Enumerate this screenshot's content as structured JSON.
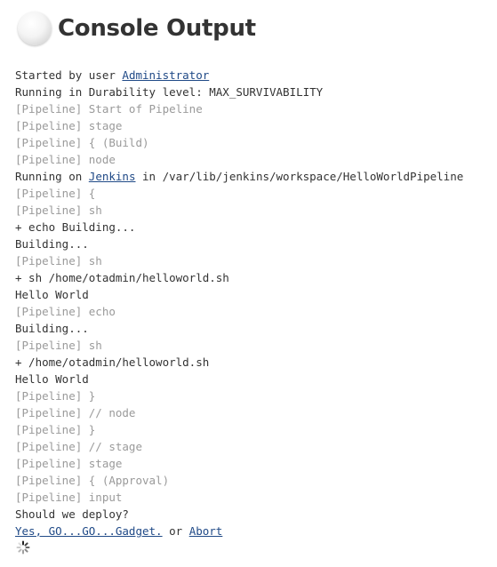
{
  "page": {
    "title": "Console Output"
  },
  "console": {
    "line1_prefix": "Started by user ",
    "line1_user_link": "Administrator",
    "line2": "Running in Durability level: MAX_SURVIVABILITY",
    "line3": "[Pipeline] Start of Pipeline",
    "line4": "[Pipeline] stage",
    "line5": "[Pipeline] { (Build)",
    "line6": "[Pipeline] node",
    "line7_prefix": "Running on ",
    "line7_link": "Jenkins",
    "line7_suffix": " in /var/lib/jenkins/workspace/HelloWorldPipeline",
    "line8": "[Pipeline] {",
    "line9": "[Pipeline] sh",
    "line10": "+ echo Building...",
    "line11": "Building...",
    "line12": "[Pipeline] sh",
    "line13": "+ sh /home/otadmin/helloworld.sh",
    "line14": "Hello World",
    "line15": "[Pipeline] echo",
    "line16": "Building...",
    "line17": "[Pipeline] sh",
    "line18": "+ /home/otadmin/helloworld.sh",
    "line19": "Hello World",
    "line20": "[Pipeline] }",
    "line21": "[Pipeline] // node",
    "line22": "[Pipeline] }",
    "line23": "[Pipeline] // stage",
    "line24": "[Pipeline] stage",
    "line25": "[Pipeline] { (Approval)",
    "line26": "[Pipeline] input",
    "line27": "Should we deploy?",
    "proceed_link": "Yes, GO...GO...Gadget.",
    "or_text": " or ",
    "abort_link": "Abort"
  },
  "icons": {
    "status": "build-status-ball-icon",
    "progress": "loading-spinner-icon"
  }
}
